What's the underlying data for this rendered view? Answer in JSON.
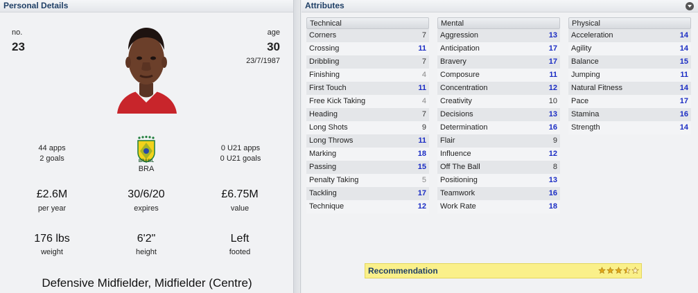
{
  "personal": {
    "title": "Personal Details",
    "no_label": "no.",
    "no_value": "23",
    "age_label": "age",
    "age_value": "30",
    "dob": "23/7/1987",
    "intl_apps": "44 apps",
    "intl_goals": "2 goals",
    "nation": "BRA",
    "crest_text": "BRASIL",
    "u21_apps": "0 U21 apps",
    "u21_goals": "0 U21 goals",
    "wage_value": "£2.6M",
    "wage_label": "per year",
    "expires_value": "30/6/20",
    "expires_label": "expires",
    "value_value": "£6.75M",
    "value_label": "value",
    "weight_value": "176 lbs",
    "weight_label": "weight",
    "height_value": "6'2\"",
    "height_label": "height",
    "foot_value": "Left",
    "foot_label": "footed",
    "position": "Defensive Midfielder, Midfielder (Centre)"
  },
  "attributes": {
    "title": "Attributes",
    "technical": {
      "label": "Technical",
      "items": [
        {
          "name": "Corners",
          "value": "7"
        },
        {
          "name": "Crossing",
          "value": "11"
        },
        {
          "name": "Dribbling",
          "value": "7"
        },
        {
          "name": "Finishing",
          "value": "4"
        },
        {
          "name": "First Touch",
          "value": "11"
        },
        {
          "name": "Free Kick Taking",
          "value": "4"
        },
        {
          "name": "Heading",
          "value": "7"
        },
        {
          "name": "Long Shots",
          "value": "9"
        },
        {
          "name": "Long Throws",
          "value": "11"
        },
        {
          "name": "Marking",
          "value": "18"
        },
        {
          "name": "Passing",
          "value": "15"
        },
        {
          "name": "Penalty Taking",
          "value": "5"
        },
        {
          "name": "Tackling",
          "value": "17"
        },
        {
          "name": "Technique",
          "value": "12"
        }
      ]
    },
    "mental": {
      "label": "Mental",
      "items": [
        {
          "name": "Aggression",
          "value": "13"
        },
        {
          "name": "Anticipation",
          "value": "17"
        },
        {
          "name": "Bravery",
          "value": "17"
        },
        {
          "name": "Composure",
          "value": "11"
        },
        {
          "name": "Concentration",
          "value": "12"
        },
        {
          "name": "Creativity",
          "value": "10"
        },
        {
          "name": "Decisions",
          "value": "13"
        },
        {
          "name": "Determination",
          "value": "16"
        },
        {
          "name": "Flair",
          "value": "9"
        },
        {
          "name": "Influence",
          "value": "12"
        },
        {
          "name": "Off The Ball",
          "value": "8"
        },
        {
          "name": "Positioning",
          "value": "13"
        },
        {
          "name": "Teamwork",
          "value": "16"
        },
        {
          "name": "Work Rate",
          "value": "18"
        }
      ]
    },
    "physical": {
      "label": "Physical",
      "items": [
        {
          "name": "Acceleration",
          "value": "14"
        },
        {
          "name": "Agility",
          "value": "14"
        },
        {
          "name": "Balance",
          "value": "15"
        },
        {
          "name": "Jumping",
          "value": "11"
        },
        {
          "name": "Natural Fitness",
          "value": "14"
        },
        {
          "name": "Pace",
          "value": "17"
        },
        {
          "name": "Stamina",
          "value": "16"
        },
        {
          "name": "Strength",
          "value": "14"
        }
      ]
    },
    "recommendation_label": "Recommendation",
    "recommendation_stars": 3.5,
    "recommendation_max": 5
  },
  "colors": {
    "header_text": "#1f3f66",
    "high_value": "#1a2cc4",
    "recommend_bg": "#faf08a"
  }
}
